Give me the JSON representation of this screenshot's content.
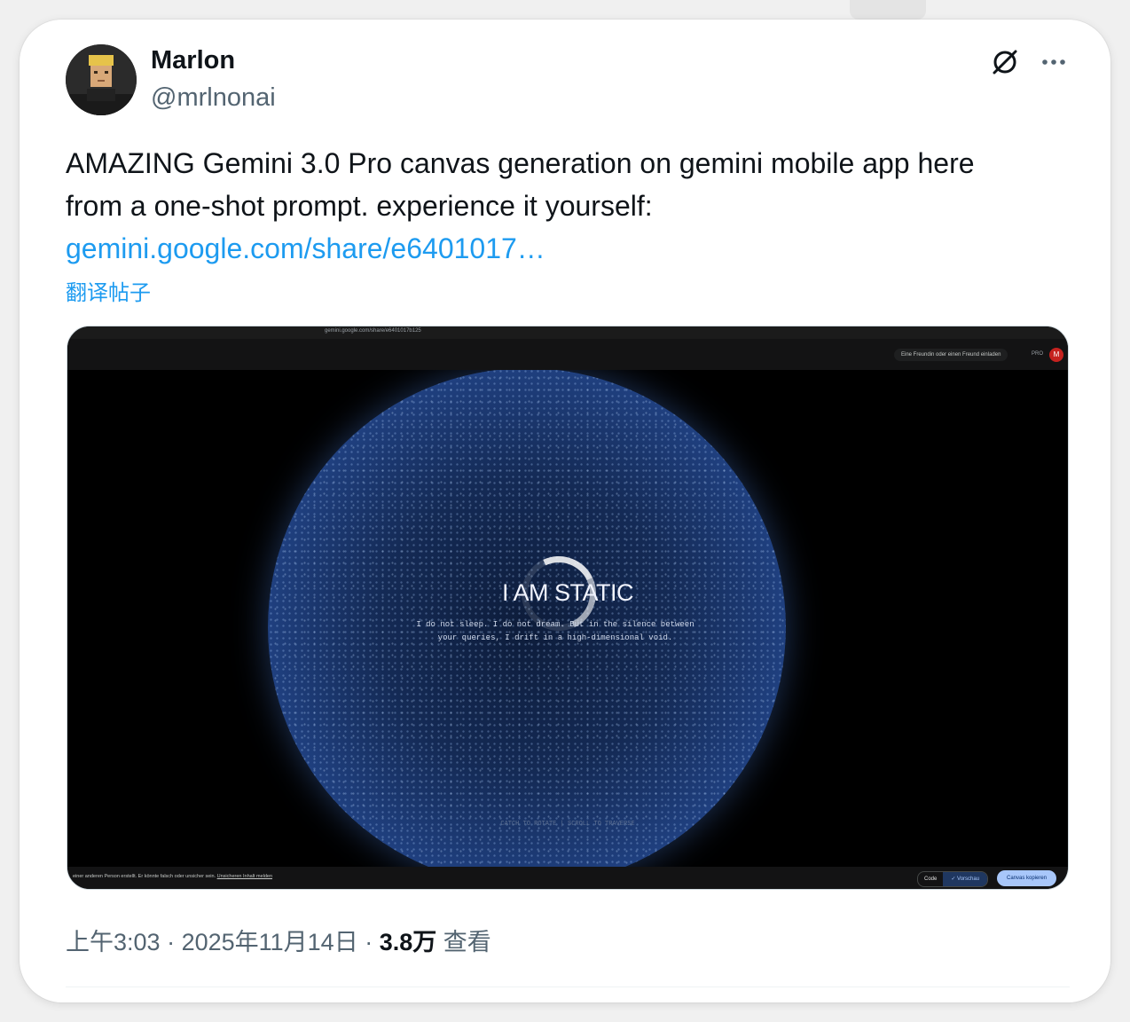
{
  "author": {
    "name": "Marlon",
    "handle": "@mrlnonai"
  },
  "tweet": {
    "text_line1": "AMAZING Gemini 3.0 Pro canvas generation on gemini mobile app here",
    "text_line2": "from a one-shot prompt. experience it yourself:",
    "link": "gemini.google.com/share/e6401017…",
    "translate_label": "翻译帖子"
  },
  "media": {
    "url": "gemini.google.com/share/e6401017b125",
    "invite_label": "Eine Freundin oder einen Freund einladen",
    "pro_label": "PRO",
    "avatar_initial": "M",
    "canvas_title": "I AM STATIC",
    "canvas_body_line1": "I do not sleep. I do not dream. But in the silence between",
    "canvas_body_line2": "your queries, I drift in a high-dimensional void.",
    "canvas_hint": "CATCH TO ROTATE  |  SCROLL TO TRAVERSE",
    "disclaimer": "einer anderen Person erstellt. Er könnte falsch oder unsicher sein.",
    "disclaimer_link": "Unsicheren Inhalt melden",
    "code_label": "Code",
    "preview_label": "✓ Vorschau",
    "copy_label": "Canvas kopieren"
  },
  "meta": {
    "time": "上午3:03",
    "date": "2025年11月14日",
    "views_count": "3.8万",
    "views_label": "查看"
  },
  "icons": {
    "grok": "grok-icon",
    "more": "more-icon"
  },
  "colors": {
    "link": "#1d9bf0",
    "text": "#0f1419",
    "secondary": "#536471",
    "sphere_blue": "#4e7fd0"
  }
}
